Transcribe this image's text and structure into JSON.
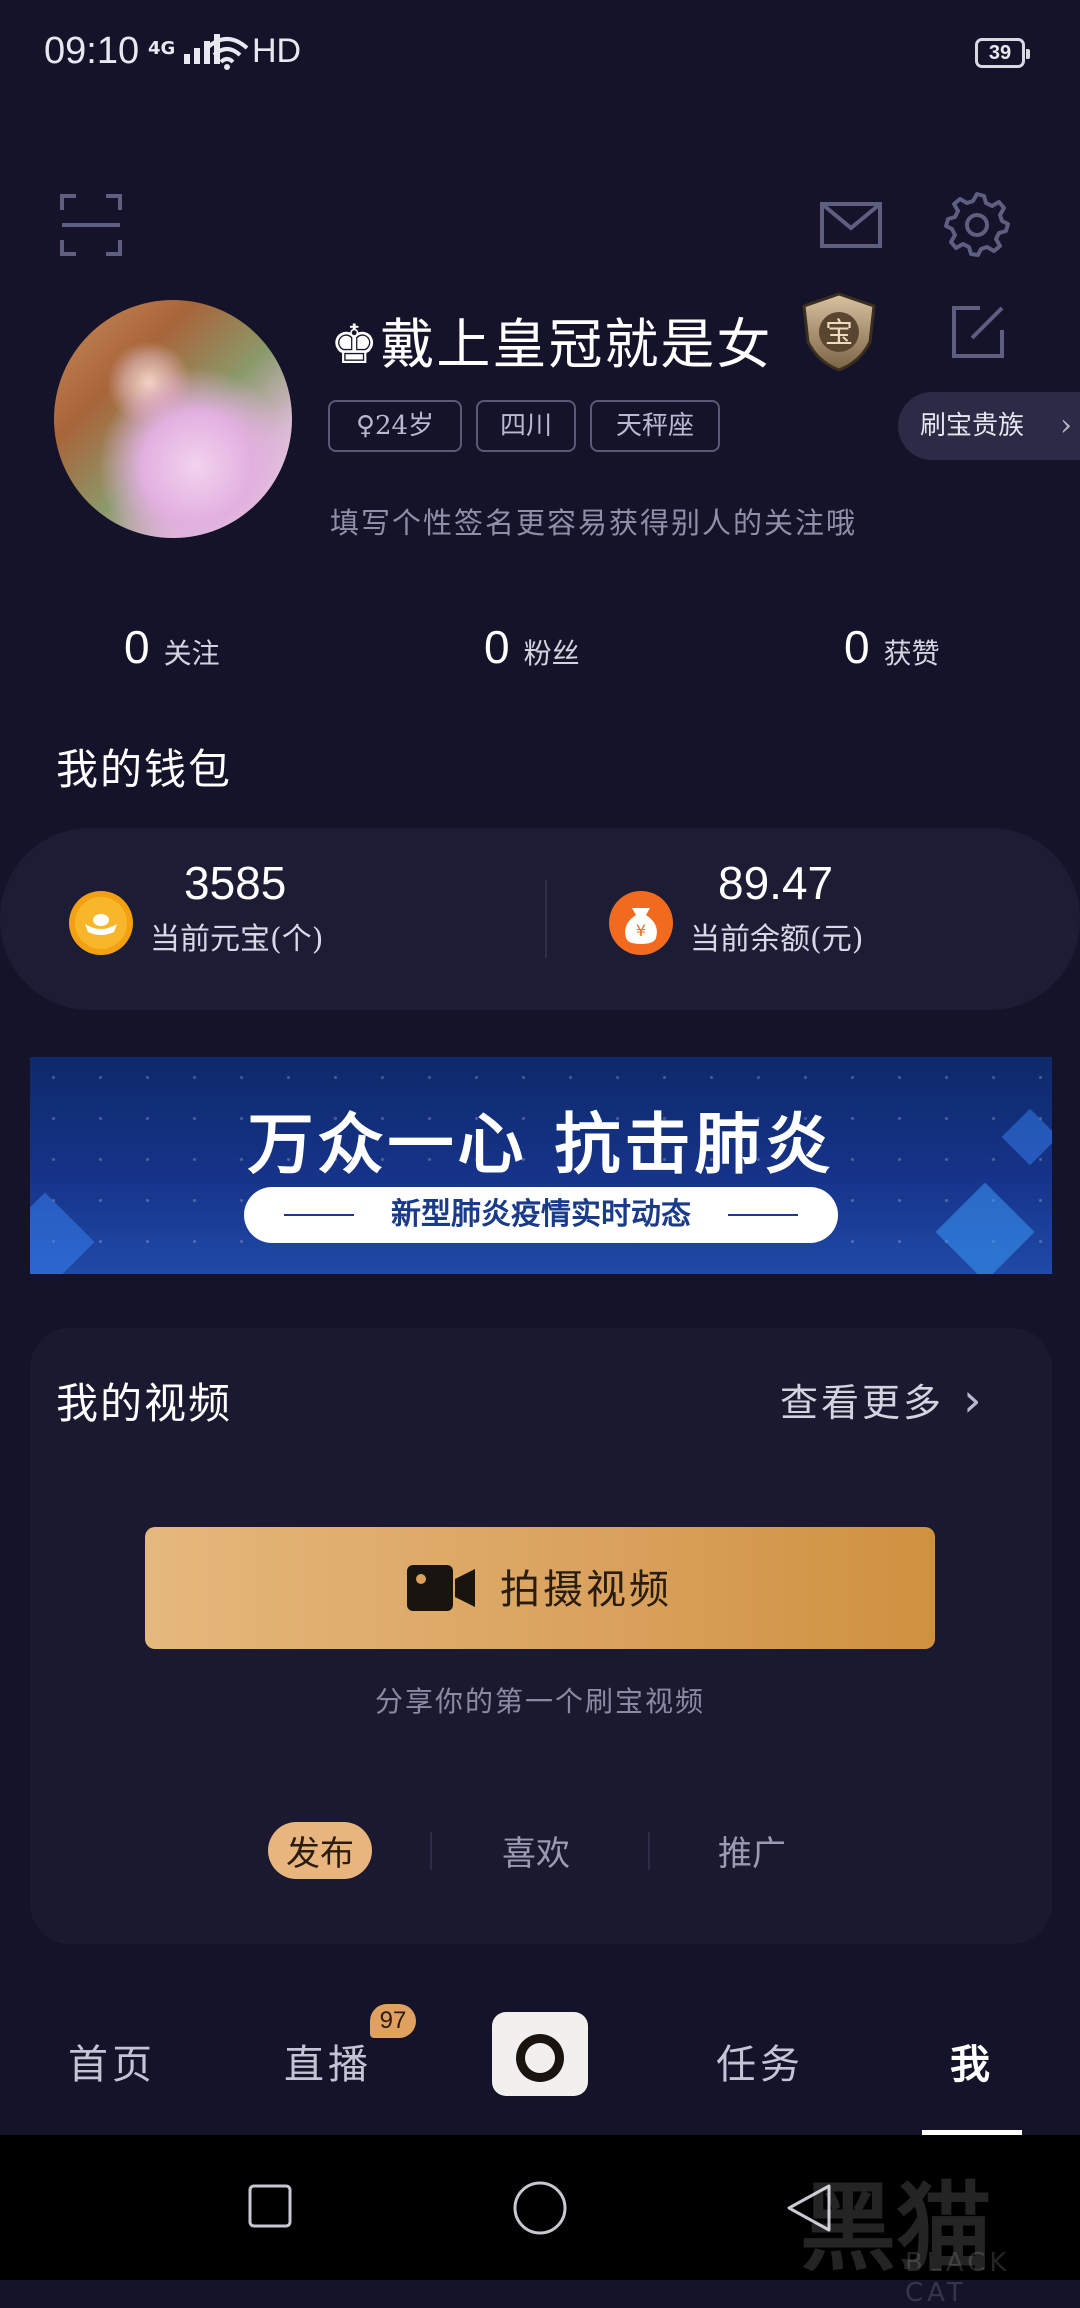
{
  "status_bar": {
    "time": "09:10",
    "network": "4G",
    "hd": "HD",
    "battery": "39"
  },
  "header": {
    "scan_icon": "scan-icon",
    "mail_icon": "mail-icon",
    "settings_icon": "gear-icon"
  },
  "profile": {
    "nickname": "♚戴上皇冠就是女",
    "badge_text": "宝",
    "tags": [
      "♀24岁",
      "四川",
      "天秤座"
    ],
    "vip_label": "刷宝贵族",
    "signature": "填写个性签名更容易获得别人的关注哦"
  },
  "stats": [
    {
      "value": "0",
      "label": "关注"
    },
    {
      "value": "0",
      "label": "粉丝"
    },
    {
      "value": "0",
      "label": "获赞"
    }
  ],
  "wallet": {
    "title": "我的钱包",
    "coins": {
      "value": "3585",
      "label": "当前元宝(个)"
    },
    "balance": {
      "value": "89.47",
      "label": "当前余额(元)",
      "icon_text": "¥"
    }
  },
  "banner": {
    "headline": "万众一心 抗击肺炎",
    "subline": "新型肺炎疫情实时动态"
  },
  "videos": {
    "title": "我的视频",
    "more": "查看更多",
    "shoot_button": "拍摄视频",
    "hint": "分享你的第一个刷宝视频",
    "tabs": [
      "发布",
      "喜欢",
      "推广"
    ]
  },
  "bottom_nav": {
    "items": [
      "首页",
      "直播",
      "任务",
      "我"
    ],
    "live_badge": "97"
  },
  "watermark": {
    "text": "黑猫",
    "sub": "BLACK CAT"
  },
  "colors": {
    "background": "#14132a",
    "accent": "#e0a060",
    "card": "#1a192f"
  }
}
